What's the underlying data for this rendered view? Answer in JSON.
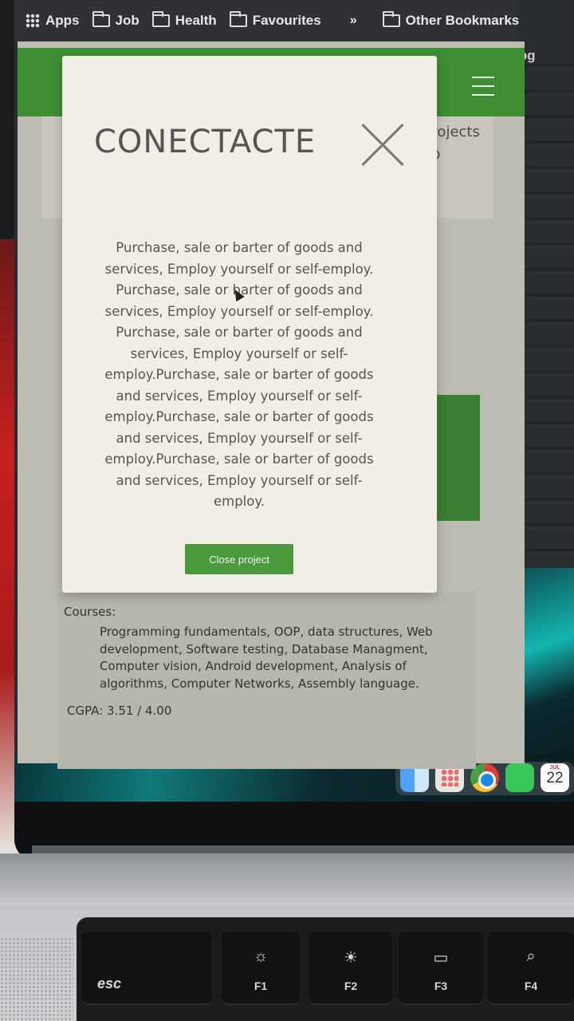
{
  "bookmarks_bar": {
    "apps": "Apps",
    "items": [
      "Job",
      "Health",
      "Favourites"
    ],
    "more": "»",
    "other": "Other Bookmarks"
  },
  "background_window": {
    "file_label": "jpg",
    "card_text_line1": "projects",
    "card_text_line2": "op"
  },
  "education": {
    "courses_label": "Courses:",
    "courses": "Programming fundamentals, OOP, data structures, Web development, Software testing, Database Managment, Computer vision, Android development, Analysis of algorithms, Computer Networks, Assembly language.",
    "cgpa": "CGPA: 3.51 / 4.00"
  },
  "modal": {
    "title": "CONECTACTE",
    "body": "Purchase, sale or barter of goods and services, Employ yourself or self-employ. Purchase, sale or barter of goods and services, Employ yourself or self-employ. Purchase, sale or barter of goods and services, Employ yourself or self-employ.Purchase, sale or barter of goods and services, Employ yourself or self-employ.Purchase, sale or barter of goods and services, Employ yourself or self-employ.Purchase, sale or barter of goods and services, Employ yourself or self-employ.",
    "close_button": "Close project",
    "close_icon": "close-icon"
  },
  "dock": {
    "apps": [
      "finder-icon",
      "launchpad-icon",
      "chrome-icon",
      "facetime-icon",
      "calendar-icon"
    ],
    "calendar_month": "JUL",
    "calendar_day": "22"
  },
  "keyboard": {
    "esc": "esc",
    "f1": "F1",
    "f2": "F2",
    "f3": "F3",
    "f4": "F4"
  },
  "colors": {
    "accent_green": "#4c9a3e",
    "header_green": "#3f8e36",
    "modal_bg": "#f1eee6"
  }
}
